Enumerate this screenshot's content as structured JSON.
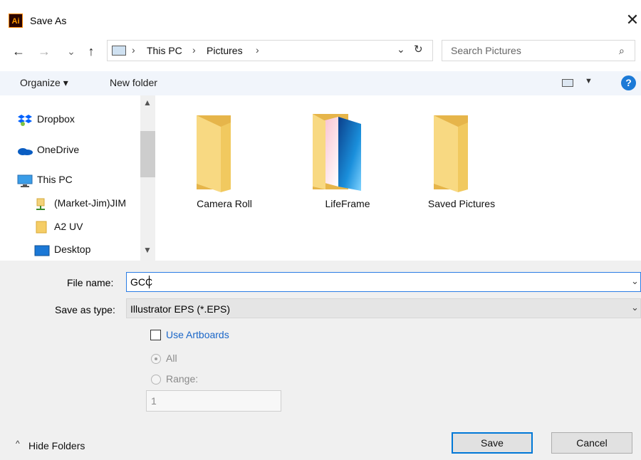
{
  "window": {
    "title": "Save As",
    "app_icon_text": "Ai",
    "close_glyph": "✕"
  },
  "nav": {
    "back": "←",
    "forward": "→",
    "recent": "⌄",
    "up": "↑",
    "breadcrumb": [
      "This PC",
      "Pictures"
    ],
    "separator": "›",
    "dropdown": "⌄",
    "refresh": "↻",
    "search_placeholder": "Search Pictures",
    "search_icon": "⌕"
  },
  "toolbar": {
    "organize": "Organize ▾",
    "new_folder": "New folder",
    "view_arrow": "▼",
    "help": "?"
  },
  "sidebar": {
    "items": [
      {
        "label": "Dropbox",
        "icon": "dropbox-icon"
      },
      {
        "label": "OneDrive",
        "icon": "onedrive-icon"
      },
      {
        "label": "This PC",
        "icon": "pc-icon"
      },
      {
        "label": "(Market-Jim)JIM",
        "icon": "network-drive-icon"
      },
      {
        "label": "A2 UV",
        "icon": "folder-icon"
      },
      {
        "label": "Desktop",
        "icon": "desktop-icon"
      }
    ],
    "scroll_up": "▲",
    "scroll_down": "▼"
  },
  "files": [
    {
      "label": "Camera Roll"
    },
    {
      "label": "LifeFrame"
    },
    {
      "label": "Saved Pictures"
    }
  ],
  "form": {
    "filename_label": "File name:",
    "filename_value": "GCC",
    "type_label": "Save as type:",
    "type_value": "Illustrator EPS (*.EPS)",
    "chevron": "⌄",
    "use_artboards": "Use Artboards",
    "all_label": "All",
    "range_label": "Range:",
    "range_value": "1"
  },
  "footer": {
    "hide_folders": "Hide Folders",
    "hide_chevron": "^",
    "save": "Save",
    "cancel": "Cancel"
  }
}
